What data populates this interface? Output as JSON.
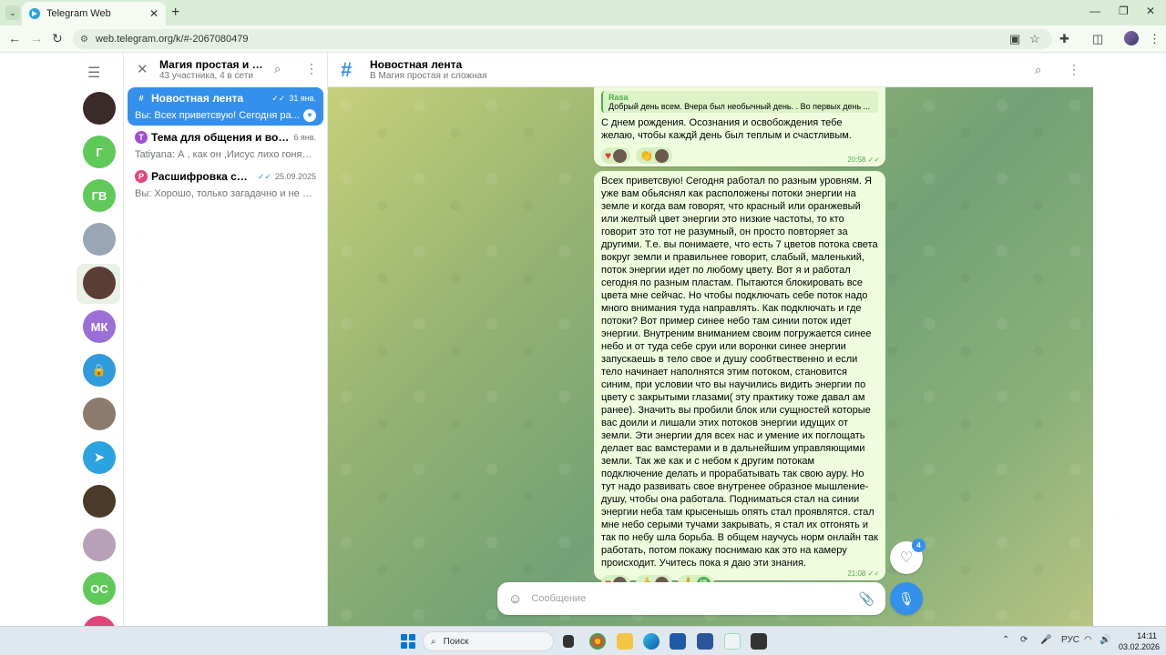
{
  "browser": {
    "tab_title": "Telegram Web",
    "url": "web.telegram.org/k/#-2067080479"
  },
  "rail": {
    "avatars": [
      {
        "initials": "",
        "color": "#3a2a2a"
      },
      {
        "initials": "Г",
        "color": "#5fc95a"
      },
      {
        "initials": "ГВ",
        "color": "#5fc95a"
      },
      {
        "initials": "",
        "color": "#9aa6b4"
      },
      {
        "initials": "",
        "color": "#5a3d34"
      },
      {
        "initials": "МК",
        "color": "#9c6fd6"
      },
      {
        "initials": "",
        "color": "#2f9bdc"
      },
      {
        "initials": "",
        "color": "#8c7a6c"
      },
      {
        "initials": "",
        "color": "#2aa3df"
      },
      {
        "initials": "",
        "color": "#4a3a2a"
      },
      {
        "initials": "",
        "color": "#b8a0b8"
      },
      {
        "initials": "ОС",
        "color": "#5fc95a"
      }
    ]
  },
  "group": {
    "title": "Магия простая и сло...",
    "subtitle": "43 участника, 4 в сети"
  },
  "topics": [
    {
      "name": "Новостная лента",
      "date": "31 янв.",
      "preview": "Вы: Всех приветсвую! Сегодня ра...",
      "icon_color": "#3390ec",
      "icon": "#",
      "active": true
    },
    {
      "name": "Тема для общения и вопрос...",
      "date": "6 янв.",
      "preview": "Tatiyana: А , как он ,Иисус лихо гонял ...",
      "icon_color": "#9c4fd6",
      "icon": "Т",
      "active": false
    },
    {
      "name": "Расшифровка снов. П...",
      "date": "25.09.2025",
      "preview": "Вы: Хорошо, только загадачно и не по...",
      "icon_color": "#e0457b",
      "icon": "Р",
      "active": false
    }
  ],
  "chat": {
    "title": "Новостная лента",
    "subtitle": "В Магия простая и сложная"
  },
  "messages": [
    {
      "reply_name": "Rasa",
      "reply_text": "Добрый день всем. Вчера был необычный день. . Во первых день ...",
      "text": "С днем рождения. Осознания и освобождения тебе желаю, чтобы каждй день был теплым и счастливым.",
      "time": "20:58"
    },
    {
      "text": "Всех приветсвую! Сегодня работал по разным уровням. Я уже вам обьяснял как расположены потоки энергии на земле и когда вам говорят, что красный или оранжевый или желтый цвет энергии это низкие частоты, то кто говорит это тот не разумный, он просто повторяет за другими.  Т.е. вы понимаете, что есть 7 цветов потока света вокруг земли и правильнее говорит, слабый, маленький, поток энергии идет по любому цвету. Вот я и работал сегодня по разным пластам. Пытаются блокировать все цвета мне сейчас. Но чтобы подключать себе поток надо много внимания туда направлять. Как подключать и где потоки? Вот пример синее небо там синии поток идет энергии. Внутреним вниманием своим погружается  синее небо и от туда себе сруи или воронки синее энергии запускаешь в тело свое и душу сообтвественно и если тело начинает наполнятся этим потоком, становится синим, при условии что вы научились видить энергии по цвету с закрытыми глазами( эту практику тоже давал ам ранее). Значить вы пробили блок или сущностей которые вас доили и лишали этих потоков энергии идущих от земли. Эти энергии для всех нас и умение их поглощать делает вас вамстерами и в дальнейшим управляющими земли. Так же как и с небом к другим потокам подключение делать и прорабатывать так свою ауру. Но тут надо развивать свое внутренее образное мышление- душу, чтобы она работала. Подниматься стал на синии энергии неба там крысенышь опять стал проявлятся. стал мне небо серыми тучами закрывать, я стал их отгонять и так по небу шла борьба. В общем научусь норм онлайн так работать, потом покажу поснимаю как это на камеру происходит. Учитесь пока я даю эти знания.",
      "time": "21:08"
    }
  ],
  "composer": {
    "placeholder": "Сообщение"
  },
  "heart_badge": "4",
  "taskbar": {
    "search_label": "Поиск",
    "lang": "РУС",
    "time": "14:11",
    "date": "03.02.2026"
  }
}
